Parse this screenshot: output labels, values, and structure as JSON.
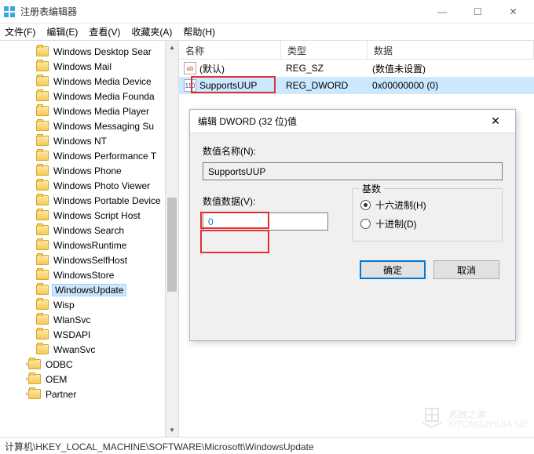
{
  "window": {
    "title": "注册表编辑器",
    "min": "—",
    "max": "☐",
    "close": "✕"
  },
  "menu": {
    "file": "文件(F)",
    "edit": "编辑(E)",
    "view": "查看(V)",
    "fav": "收藏夹(A)",
    "help": "帮助(H)"
  },
  "tree": [
    {
      "label": "Windows Desktop Sear",
      "chev": "›"
    },
    {
      "label": "Windows Mail",
      "chev": ""
    },
    {
      "label": "Windows Media Device",
      "chev": "›"
    },
    {
      "label": "Windows Media Founda",
      "chev": "›"
    },
    {
      "label": "Windows Media Player",
      "chev": "›"
    },
    {
      "label": "Windows Messaging Su",
      "chev": "›"
    },
    {
      "label": "Windows NT",
      "chev": "›"
    },
    {
      "label": "Windows Performance T",
      "chev": ""
    },
    {
      "label": "Windows Phone",
      "chev": "›"
    },
    {
      "label": "Windows Photo Viewer",
      "chev": "›"
    },
    {
      "label": "Windows Portable Device",
      "chev": "›"
    },
    {
      "label": "Windows Script Host",
      "chev": "›"
    },
    {
      "label": "Windows Search",
      "chev": "›"
    },
    {
      "label": "WindowsRuntime",
      "chev": "›"
    },
    {
      "label": "WindowsSelfHost",
      "chev": "›"
    },
    {
      "label": "WindowsStore",
      "chev": "›"
    },
    {
      "label": "WindowsUpdate",
      "chev": "›",
      "selected": true
    },
    {
      "label": "Wisp",
      "chev": "›"
    },
    {
      "label": "WlanSvc",
      "chev": "›"
    },
    {
      "label": "WSDAPI",
      "chev": "›"
    },
    {
      "label": "WwanSvc",
      "chev": "›"
    }
  ],
  "tree_outer": [
    {
      "label": "ODBC",
      "chev": "›"
    },
    {
      "label": "OEM",
      "chev": "›"
    },
    {
      "label": "Partner",
      "chev": "›"
    }
  ],
  "list": {
    "headers": {
      "name": "名称",
      "type": "类型",
      "data": "数据"
    },
    "rows": [
      {
        "icon": "ab",
        "name": "(默认)",
        "type": "REG_SZ",
        "data": "(数值未设置)"
      },
      {
        "icon": "dw",
        "name": "SupportsUUP",
        "type": "REG_DWORD",
        "data": "0x00000000 (0)",
        "selected": true
      }
    ]
  },
  "dialog": {
    "title": "编辑 DWORD (32 位)值",
    "name_label": "数值名称(N):",
    "name_value": "SupportsUUP",
    "data_label": "数值数据(V):",
    "data_value": "0",
    "radix_label": "基数",
    "radix_hex": "十六进制(H)",
    "radix_dec": "十进制(D)",
    "ok": "确定",
    "cancel": "取消",
    "close": "✕"
  },
  "statusbar": "计算机\\HKEY_LOCAL_MACHINE\\SOFTWARE\\Microsoft\\WindowsUpdate",
  "watermark": "系统之家"
}
